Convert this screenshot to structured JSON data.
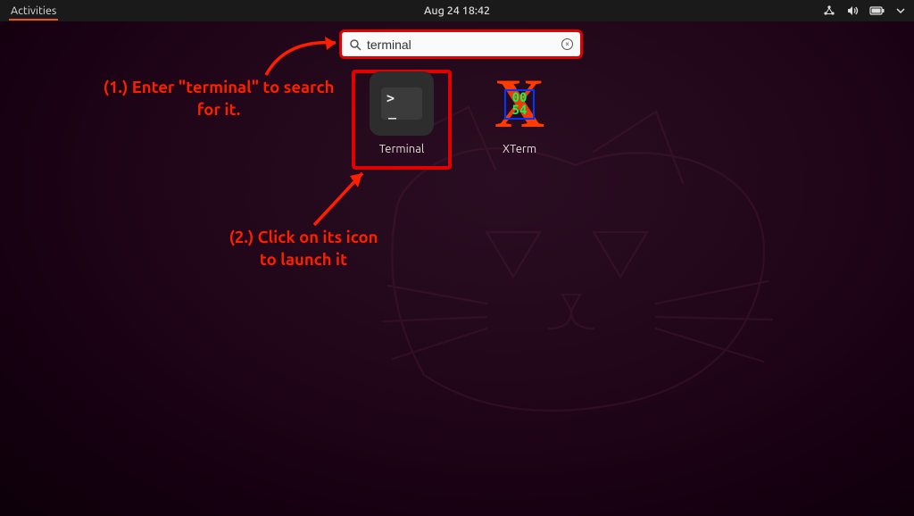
{
  "topbar": {
    "activities_label": "Activities",
    "datetime": "Aug 24  18:42"
  },
  "search": {
    "value": "terminal"
  },
  "results": [
    {
      "id": "terminal",
      "label": "Terminal",
      "selected": true
    },
    {
      "id": "xterm",
      "label": "XTerm",
      "selected": false,
      "xterm_digits_top": "00",
      "xterm_digits_bottom": "54"
    }
  ],
  "annotations": {
    "step1": "(1.) Enter \"terminal\" to search for it.",
    "step2": "(2.) Click on its icon to launch it"
  },
  "icons": {
    "search": "search-icon",
    "clear": "clear-icon",
    "network": "network-icon",
    "volume": "volume-icon",
    "battery": "battery-icon",
    "dropdown": "chevron-down-icon",
    "terminal_prompt": ">",
    "terminal_cursor": "_"
  },
  "colors": {
    "accent_orange": "#e95420",
    "annotation_red": "#e30000"
  }
}
